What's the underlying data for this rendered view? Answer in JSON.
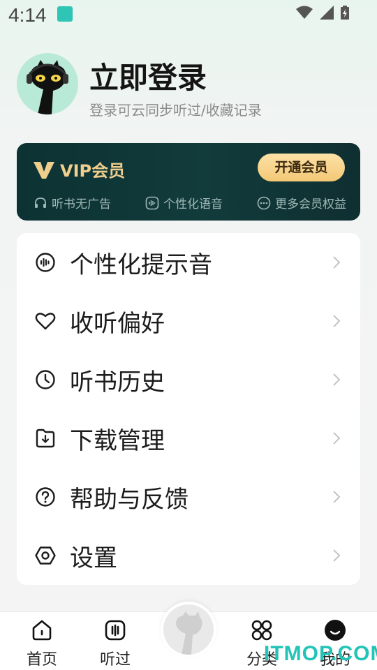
{
  "status_bar": {
    "time": "4:14"
  },
  "profile": {
    "title": "立即登录",
    "subtitle": "登录可云同步听过/收藏记录"
  },
  "vip": {
    "title": "VIP会员",
    "open_button": "开通会员",
    "benefits": [
      {
        "icon": "headphones-icon",
        "label": "听书无广告"
      },
      {
        "icon": "voice-wave-icon",
        "label": "个性化语音"
      },
      {
        "icon": "more-dots-icon",
        "label": "更多会员权益"
      }
    ],
    "gold": "#f0cf8e"
  },
  "menu": {
    "items": [
      {
        "icon": "sound-wave-icon",
        "label": "个性化提示音"
      },
      {
        "icon": "heart-icon",
        "label": "收听偏好"
      },
      {
        "icon": "clock-icon",
        "label": "听书历史"
      },
      {
        "icon": "download-icon",
        "label": "下载管理"
      },
      {
        "icon": "question-icon",
        "label": "帮助与反馈"
      },
      {
        "icon": "settings-icon",
        "label": "设置"
      }
    ]
  },
  "nav": {
    "items": [
      {
        "icon": "home-icon",
        "label": "首页"
      },
      {
        "icon": "listened-icon",
        "label": "听过"
      },
      {
        "icon": "category-icon",
        "label": "分类"
      },
      {
        "icon": "profile-icon",
        "label": "我的"
      }
    ]
  },
  "watermark": "ITMOP.COM"
}
